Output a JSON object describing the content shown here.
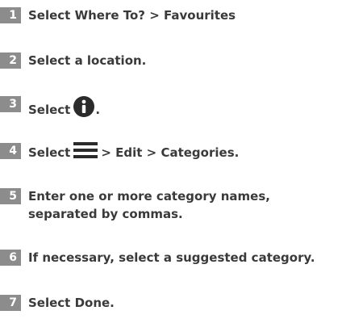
{
  "steps": [
    {
      "number": "1",
      "text": "Select Where To? > Favourites"
    },
    {
      "number": "2",
      "text": "Select a location."
    },
    {
      "number": "3",
      "before": "Select",
      "icon": "info-icon",
      "after": "."
    },
    {
      "number": "4",
      "before": "Select",
      "icon": "menu-icon",
      "after": "> Edit > Categories."
    },
    {
      "number": "5",
      "line1": "Enter one or more category names,",
      "line2": "separated by commas."
    },
    {
      "number": "6",
      "text": "If necessary, select a suggested category."
    },
    {
      "number": "7",
      "text": "Select Done."
    }
  ],
  "colors": {
    "number_badge": "#8c8c8c",
    "text": "#3a3a3a",
    "icon": "#2b2b2b"
  }
}
